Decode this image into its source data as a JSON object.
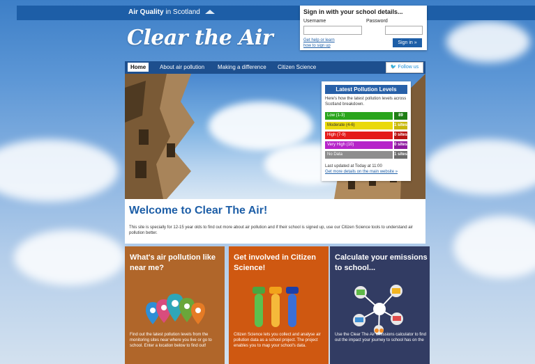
{
  "site": {
    "brand": "Air Quality",
    "brand_in": "in Scotland",
    "logo": "Clear the Air"
  },
  "signin": {
    "title": "Sign in with your school details...",
    "username_label": "Username",
    "password_label": "Password",
    "help_line1": "Get help or learn",
    "help_line2": "how to sign up",
    "button": "Sign in »"
  },
  "nav": {
    "items": [
      "Home",
      "About air pollution",
      "Making a difference",
      "Citizen Science"
    ],
    "follow": "Follow us"
  },
  "pollution": {
    "title": "Latest Pollution Levels",
    "intro": "Here's how the latest pollution levels across Scotland breakdown.",
    "levels": [
      {
        "label": "Low (1-3)",
        "count": "89 sites",
        "color": "#2aa51c"
      },
      {
        "label": "Moderate (4-6)",
        "count": "1 sites",
        "color": "#ead90c"
      },
      {
        "label": "High (7-9)",
        "count": "0 sites",
        "color": "#e41b1b"
      },
      {
        "label": "Very High (10)",
        "count": "0 sites",
        "color": "#b624c9"
      },
      {
        "label": "No Data",
        "count": "1 sites",
        "color": "#8e8e8e"
      }
    ],
    "updated": "Last updated at Today at 11:00",
    "more_link": "Get more details on the main website »"
  },
  "welcome": {
    "title": "Welcome to Clear The Air!",
    "text": "This site is specially for 12-15 year olds to find out more about air pollution and if their school is signed up, use our Citizen Science tools to understand air pollution better."
  },
  "cards": [
    {
      "title": "What's air pollution like near me?",
      "desc": "Find out the latest pollution levels from the monitoring sites near where you live or go to school. Enter a location below to find out!",
      "color": "#b0662a"
    },
    {
      "title": "Get involved in Citizen Science!",
      "desc": "Citizen Science lets you collect and analyse air pollution data as a school project. The project enables you to map your school's data.",
      "color": "#cf5811"
    },
    {
      "title": "Calculate your emissions to school...",
      "desc": "Use the Clear The Air emissions calculator to find out the impact your journey to school has on the",
      "color": "#323c63"
    }
  ],
  "colors": {
    "brand_blue": "#1d5ea7",
    "nav_blue": "#1d4f8e"
  }
}
